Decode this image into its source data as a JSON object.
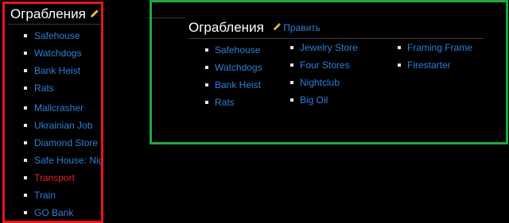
{
  "left_panel": {
    "title": "Ограбления",
    "items": [
      {
        "label": "Safehouse",
        "color": "#2f7fd6"
      },
      {
        "label": "Watchdogs",
        "color": "#2f7fd6"
      },
      {
        "label": "Bank Heist",
        "color": "#2f7fd6"
      },
      {
        "label": "Rats",
        "color": "#2f7fd6"
      },
      {
        "label": "Mallcrasher",
        "color": "#2f7fd6"
      },
      {
        "label": "Ukrainian Job",
        "color": "#2f7fd6"
      },
      {
        "label": "Diamond Store",
        "color": "#2f7fd6"
      },
      {
        "label": "Safe House: Nig",
        "color": "#2f7fd6"
      },
      {
        "label": "Transport",
        "color": "#e8231d"
      },
      {
        "label": "Train",
        "color": "#2f7fd6"
      },
      {
        "label": "GO Bank",
        "color": "#2f7fd6"
      }
    ],
    "edit_icon": "pencil-icon",
    "border_color": "#e8161c"
  },
  "right_panel": {
    "title": "Ограбления",
    "edit_label": "Править",
    "edit_icon": "pencil-icon",
    "border_color": "#1fa83a",
    "columns": [
      [
        "Safehouse",
        "Watchdogs",
        "Bank Heist",
        "Rats"
      ],
      [
        "Jewelry Store",
        "Four Stores",
        "Nightclub",
        "Big Oil"
      ],
      [
        "Framing Frame",
        "Firestarter"
      ]
    ]
  },
  "colors": {
    "link": "#2f7fd6",
    "link_missing": "#e8231d",
    "background": "#000000"
  }
}
